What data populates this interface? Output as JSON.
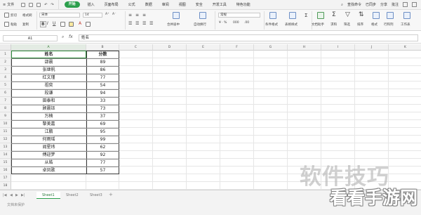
{
  "menubar": {
    "file_label": "文件",
    "tabs": [
      "开始",
      "插入",
      "页面布局",
      "公式",
      "数据",
      "审阅",
      "视图",
      "安全",
      "开发工具",
      "特色功能"
    ],
    "active_tab_index": 0,
    "search_label": "查找命令",
    "sync_label": "已同步",
    "share_label": "分享",
    "comment_label": "批注"
  },
  "ribbon": {
    "cut_label": "剪切",
    "paste_label": "粘贴",
    "copy_label": "复制",
    "format_painter_label": "格式刷",
    "font_name": "宋体",
    "font_size": "14",
    "bold": "B",
    "italic": "I",
    "underline": "U",
    "merge_center_label": "合并居中",
    "wrap_text_label": "自动换行",
    "number_format": "常规",
    "conditional_format_label": "条件格式",
    "table_style_label": "表格样式",
    "doc_helper_label": "文档助手",
    "sum_label": "求和",
    "filter_label": "筛选",
    "sort_label": "排序",
    "format_label": "格式",
    "row_col_label": "行和列",
    "worksheet_label": "工作表"
  },
  "formula_bar": {
    "cell_ref": "A1",
    "fx_symbol": "fx",
    "content": "姓名"
  },
  "grid": {
    "columns": [
      "A",
      "B",
      "C",
      "D",
      "E",
      "F",
      "G",
      "H",
      "I",
      "J",
      "K"
    ],
    "selected_column": "A",
    "rows": [
      "1",
      "2",
      "3",
      "4",
      "5",
      "6",
      "7",
      "8",
      "9",
      "10",
      "11",
      "12",
      "13",
      "14",
      "15",
      "16",
      "17",
      "18"
    ],
    "headers": [
      "姓名",
      "分数"
    ],
    "records": [
      [
        "邵晨",
        "89"
      ],
      [
        "张继帆",
        "86"
      ],
      [
        "红文瑾",
        "77"
      ],
      [
        "祖奕",
        "54"
      ],
      [
        "段谦",
        "94"
      ],
      [
        "田泰和",
        "33"
      ],
      [
        "顾晨钰",
        "73"
      ],
      [
        "万楠",
        "37"
      ],
      [
        "黎美嘉",
        "69"
      ],
      [
        "江鹏",
        "95"
      ],
      [
        "何雨瑶",
        "99"
      ],
      [
        "阎星纬",
        "62"
      ],
      [
        "傅迎梦",
        "92"
      ],
      [
        "从皓",
        "77"
      ],
      [
        "卓凤歌",
        "57"
      ]
    ]
  },
  "sheets": {
    "tabs": [
      "Sheet1",
      "Sheet2",
      "Sheet3"
    ],
    "active_index": 0,
    "add_symbol": "+"
  },
  "status": {
    "text": "文档未保护"
  },
  "watermark": {
    "top": "软件技巧",
    "bottom": "看看手游网"
  },
  "colors": {
    "accent": "#2c9f4c",
    "selection": "#2d8a3a"
  }
}
